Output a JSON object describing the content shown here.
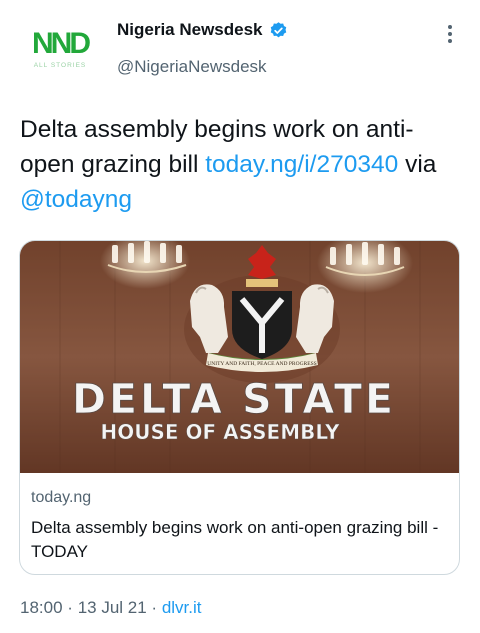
{
  "author": {
    "display_name": "Nigeria Newsdesk",
    "handle": "@NigeriaNewsdesk",
    "avatar_text": "NND",
    "avatar_subtext": "ALL STORIES",
    "verified": true
  },
  "tweet": {
    "text_plain": "Delta assembly begins work on anti-open grazing bill",
    "link": "today.ng/i/270340",
    "via_word": "via",
    "mention": "@todayng"
  },
  "card": {
    "image_line1": "DELTA STATE",
    "image_line2": "HOUSE OF ASSEMBLY",
    "image_motto": "UNITY AND FAITH, PEACE AND PROGRESS",
    "domain": "today.ng",
    "title": "Delta assembly begins work on anti-open grazing bill - TODAY"
  },
  "meta": {
    "time": "18:00",
    "date": "13 Jul 21",
    "source": "dlvr.it",
    "separator": "·"
  },
  "colors": {
    "link": "#1d9bf0",
    "secondary": "#536471",
    "avatar_green": "#22a83a"
  }
}
